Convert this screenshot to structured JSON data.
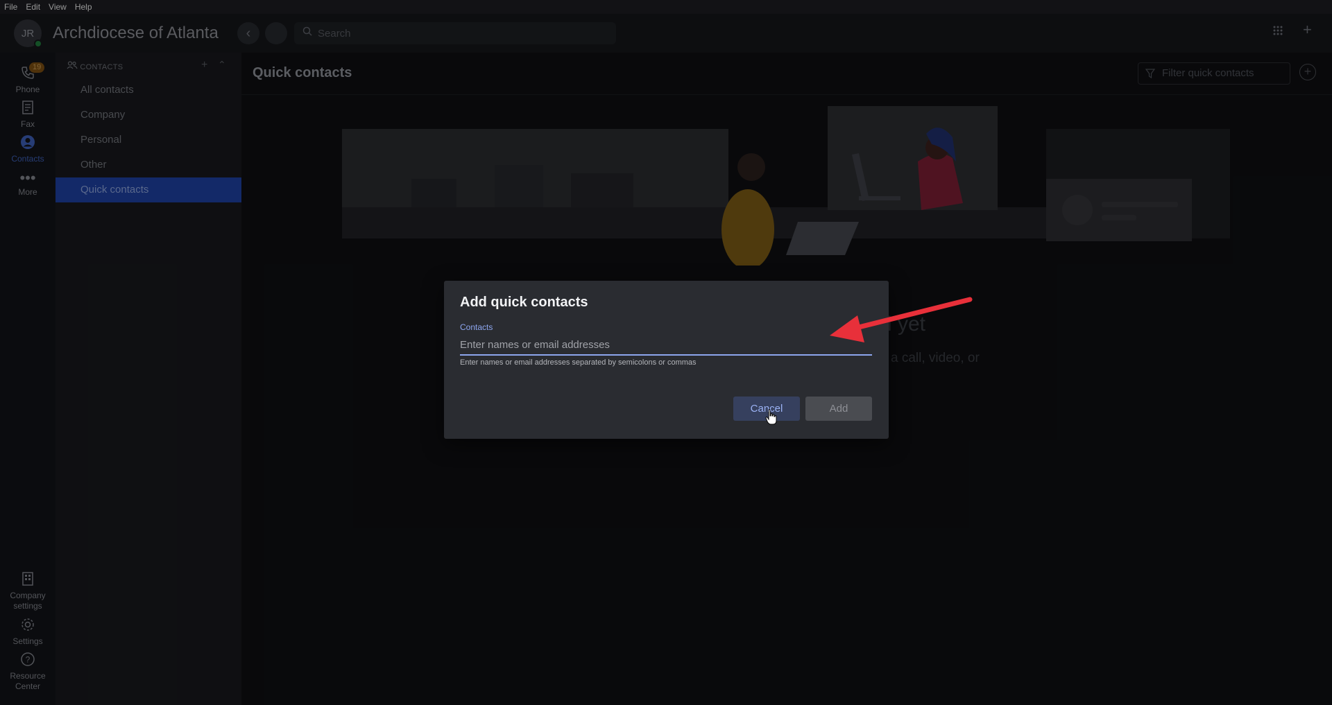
{
  "menubar": {
    "items": [
      {
        "label": "File"
      },
      {
        "label": "Edit"
      },
      {
        "label": "View"
      },
      {
        "label": "Help"
      }
    ]
  },
  "header": {
    "avatar_initials": "JR",
    "org_name": "Archdiocese of Atlanta",
    "search_placeholder": "Search"
  },
  "rail": {
    "phone": {
      "label": "Phone",
      "badge": "19"
    },
    "fax": {
      "label": "Fax"
    },
    "contacts": {
      "label": "Contacts"
    },
    "more": {
      "label": "More"
    },
    "company_settings": {
      "label": "Company settings"
    },
    "settings": {
      "label": "Settings"
    },
    "resource_center": {
      "label": "Resource Center"
    }
  },
  "sidebar": {
    "heading": "CONTACTS",
    "items": [
      {
        "label": "All contacts"
      },
      {
        "label": "Company"
      },
      {
        "label": "Personal"
      },
      {
        "label": "Other"
      },
      {
        "label": "Quick contacts"
      }
    ]
  },
  "main": {
    "title": "Quick contacts",
    "filter_placeholder": "Filter quick contacts",
    "empty_title_fragment": "l yet",
    "empty_text_fragment": "a call, video, or"
  },
  "dialog": {
    "title": "Add quick contacts",
    "field_label": "Contacts",
    "input_placeholder": "Enter names or email addresses",
    "input_value": "",
    "helper_text": "Enter names or email addresses separated by semicolons or commas",
    "cancel_label": "Cancel",
    "add_label": "Add"
  },
  "colors": {
    "accent": "#8da6ef",
    "active_nav": "#1e3fa0",
    "arrow": "#e8303a"
  }
}
